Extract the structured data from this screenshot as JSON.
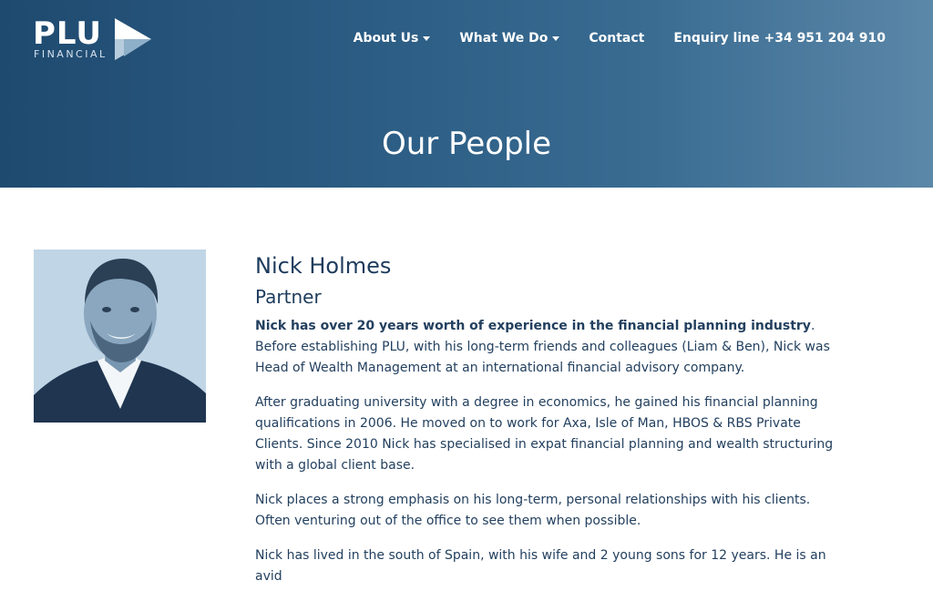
{
  "brand": {
    "name": "PLU",
    "sub": "FINANCIAL",
    "colors": {
      "hero_start": "#1f4a70",
      "hero_end": "#5b87a8",
      "text": "#1d3b5c"
    }
  },
  "nav": {
    "about": "About Us",
    "what": "What We Do",
    "contact": "Contact",
    "enquiry": "Enquiry line +34 951 204 910"
  },
  "page_title": "Our People",
  "person": {
    "name": "Nick Holmes",
    "role": "Partner",
    "p1_bold": "Nick has over 20 years worth of experience in the financial planning industry",
    "p1_rest": ". Before establishing PLU, with his long-term friends and colleagues (Liam & Ben), Nick was Head of Wealth Management at an international financial advisory company.",
    "p2": "After graduating university with a degree in economics, he gained his financial planning qualifications in 2006. He moved on to work for Axa, Isle of Man, HBOS & RBS Private Clients. Since 2010 Nick has specialised in expat financial planning and wealth structuring with a global client base.",
    "p3": "Nick places a strong emphasis on his long-term, personal relationships with his clients. Often venturing out of the office to see them when possible.",
    "p4": "Nick has lived in the south of Spain, with his wife and 2 young sons for 12 years. He is an avid"
  },
  "icons": {
    "logo_mark": "triangle-flag-icon",
    "dropdown": "chevron-down-icon"
  }
}
